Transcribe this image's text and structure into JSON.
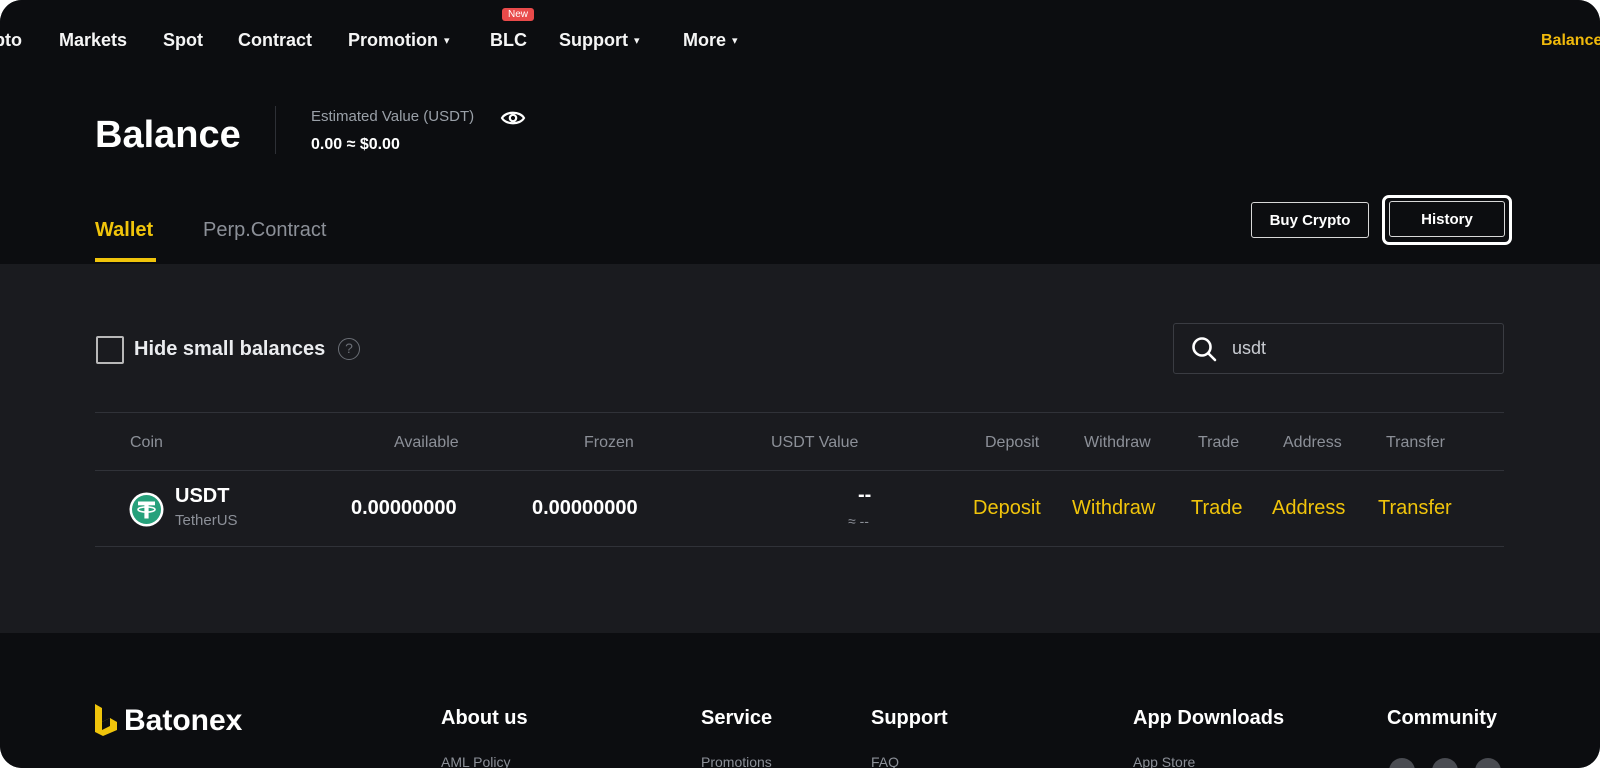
{
  "nav": {
    "items": [
      {
        "label": "pto",
        "has_caret": false
      },
      {
        "label": "Markets",
        "has_caret": false
      },
      {
        "label": "Spot",
        "has_caret": false
      },
      {
        "label": "Contract",
        "has_caret": false
      },
      {
        "label": "Promotion",
        "has_caret": true
      },
      {
        "label": "BLC",
        "has_caret": false
      },
      {
        "label": "Support",
        "has_caret": true
      },
      {
        "label": "More",
        "has_caret": true
      }
    ],
    "new_badge": "New",
    "caret": "▾",
    "balance_link": "Balance"
  },
  "header": {
    "title": "Balance",
    "estimated_label": "Estimated Value (USDT)",
    "estimated_value": "0.00 ≈ $0.00"
  },
  "tabs": [
    {
      "label": "Wallet",
      "active": true
    },
    {
      "label": "Perp.Contract",
      "active": false
    }
  ],
  "actions": {
    "buy_crypto": "Buy Crypto",
    "history": "History"
  },
  "filters": {
    "hide_small_label": "Hide small balances",
    "hide_small_checked": false,
    "help_glyph": "?",
    "search_value": "usdt",
    "search_placeholder": ""
  },
  "table": {
    "headers": [
      "Coin",
      "Available",
      "Frozen",
      "USDT Value",
      "Deposit",
      "Withdraw",
      "Trade",
      "Address",
      "Transfer"
    ],
    "rows": [
      {
        "symbol": "USDT",
        "name": "TetherUS",
        "available": "0.00000000",
        "frozen": "0.00000000",
        "usdt_value": "--",
        "usdt_approx": "≈ --",
        "actions": [
          "Deposit",
          "Withdraw",
          "Trade",
          "Address",
          "Transfer"
        ]
      }
    ]
  },
  "footer": {
    "brand": "Batonex",
    "columns": [
      {
        "heading": "About us",
        "first_link": "AML Policy"
      },
      {
        "heading": "Service",
        "first_link": "Promotions"
      },
      {
        "heading": "Support",
        "first_link": "FAQ"
      },
      {
        "heading": "App Downloads",
        "first_link": "App Store"
      },
      {
        "heading": "Community",
        "first_link": ""
      }
    ]
  },
  "colors": {
    "accent_yellow": "#f0c40b",
    "background": "#0c0d10",
    "panel": "#1a1b1f",
    "tether_green": "#26a17b",
    "badge_red": "#e94a4a"
  }
}
